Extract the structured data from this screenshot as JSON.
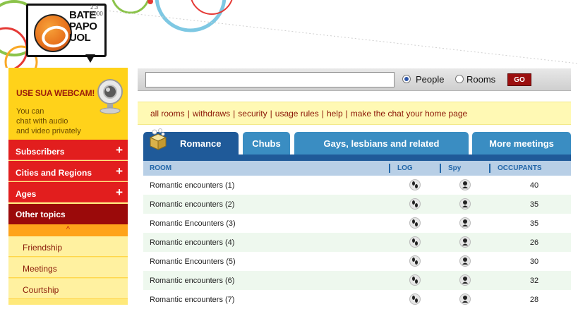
{
  "header": {
    "online_text": "2.3 3000",
    "logo_lines": [
      "BATE",
      "PAPO",
      "UOL"
    ]
  },
  "sidebar": {
    "webcam_title": "USE SUA WEBCAM!",
    "webcam_desc": [
      "You can",
      "chat with audio",
      "and video privately"
    ],
    "menu": [
      {
        "label": "Subscribers",
        "expand": "+"
      },
      {
        "label": "Cities and Regions",
        "expand": "+"
      },
      {
        "label": "Ages",
        "expand": "+"
      }
    ],
    "other_topics": "Other topics",
    "collapse_icon": "^",
    "subitems": [
      "Friendship",
      "Meetings",
      "Courtship"
    ]
  },
  "search": {
    "value": "",
    "placeholder": "",
    "options": [
      {
        "label": "People",
        "selected": true
      },
      {
        "label": "Rooms",
        "selected": false
      }
    ],
    "go_label": "GO"
  },
  "links": [
    "all rooms",
    "withdraws",
    "security",
    "usage rules",
    "help",
    "make the chat your home page"
  ],
  "tabs": [
    {
      "label": "Romance",
      "active": true
    },
    {
      "label": "Chubs",
      "active": false
    },
    {
      "label": "Gays, lesbians and related",
      "active": false
    },
    {
      "label": "More meetings",
      "active": false
    }
  ],
  "table": {
    "headers": [
      "ROOM",
      "LOG",
      "Spy",
      "OCCUPANTS"
    ],
    "rows": [
      {
        "room": "Romantic encounters (1)",
        "occupants": "40"
      },
      {
        "room": "Romantic encounters (2)",
        "occupants": "35"
      },
      {
        "room": "Romantic Encounters (3)",
        "occupants": "35"
      },
      {
        "room": "Romantic encounters (4)",
        "occupants": "26"
      },
      {
        "room": "Romantic Encounters (5)",
        "occupants": "30"
      },
      {
        "room": "Romantic encounters (6)",
        "occupants": "32"
      },
      {
        "room": "Romantic encounters (7)",
        "occupants": "28"
      }
    ]
  },
  "colors": {
    "accent_red": "#e21e1e",
    "dark_red": "#9b0a0a",
    "tab_blue": "#3a8dc2",
    "tab_active": "#1f5a99"
  }
}
